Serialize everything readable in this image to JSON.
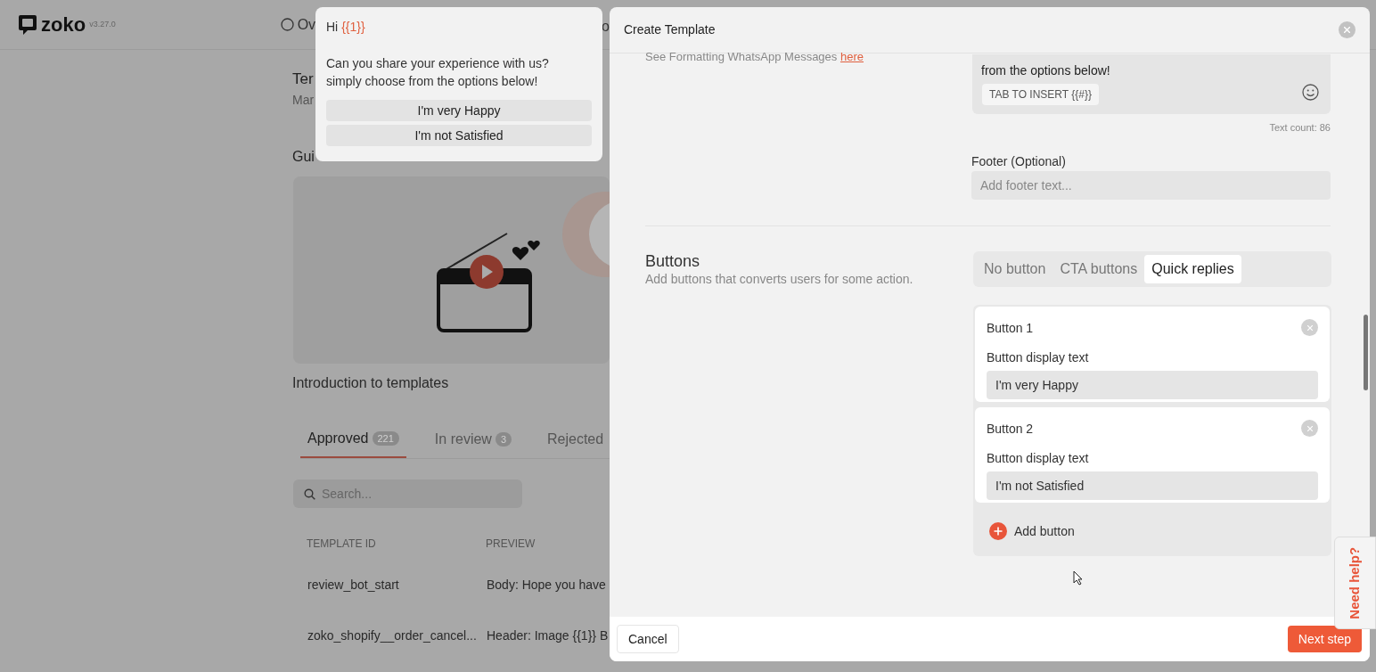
{
  "app": {
    "logo": "zoko",
    "version": "v3.27.0",
    "nav_fragments": [
      "Ov",
      "o"
    ],
    "page_title_fragment": "Ter",
    "page_subtitle_fragment": "Mar",
    "guide_fragment": "Gui",
    "video_caption": "Introduction to templates",
    "tabs": [
      {
        "label": "Approved",
        "count": "221",
        "selected": true
      },
      {
        "label": "In review",
        "count": "3",
        "selected": false
      },
      {
        "label": "Rejected",
        "selected": false
      }
    ],
    "search": {
      "placeholder": "Search..."
    },
    "table": {
      "columns": [
        "TEMPLATE ID",
        "PREVIEW"
      ],
      "rows": [
        [
          "review_bot_start",
          "Body: Hope you have"
        ],
        [
          "zoko_shopify__order_cancel...",
          "Header: Image {{1}} B"
        ]
      ]
    }
  },
  "preview": {
    "greeting": "Hi",
    "variable": "{{1}}",
    "body": "Can you share your experience with us? simply choose from the options below!",
    "quick_replies": [
      "I'm very Happy",
      "I'm not Satisfied"
    ]
  },
  "modal": {
    "title": "Create Template",
    "formatting_hint": "See Formatting WhatsApp Messages",
    "formatting_link": "here",
    "body_text": "from the options below!",
    "insert_chip": "TAB TO INSERT {{#}}",
    "text_count": "Text count: 86",
    "footer": {
      "label": "Footer (Optional)",
      "placeholder": "Add footer text..."
    },
    "buttons_section": {
      "title": "Buttons",
      "description": "Add buttons that converts users for some action.",
      "types": [
        {
          "label": "No button",
          "selected": false
        },
        {
          "label": "CTA buttons",
          "selected": false
        },
        {
          "label": "Quick replies",
          "selected": true
        }
      ],
      "items": [
        {
          "title": "Button 1",
          "field_label": "Button display text",
          "value": "I'm very Happy"
        },
        {
          "title": "Button 2",
          "field_label": "Button display text",
          "value": "I'm not Satisfied"
        }
      ],
      "add_label": "Add button"
    },
    "cancel": "Cancel",
    "next": "Next step"
  },
  "help_tab": "Need help?"
}
